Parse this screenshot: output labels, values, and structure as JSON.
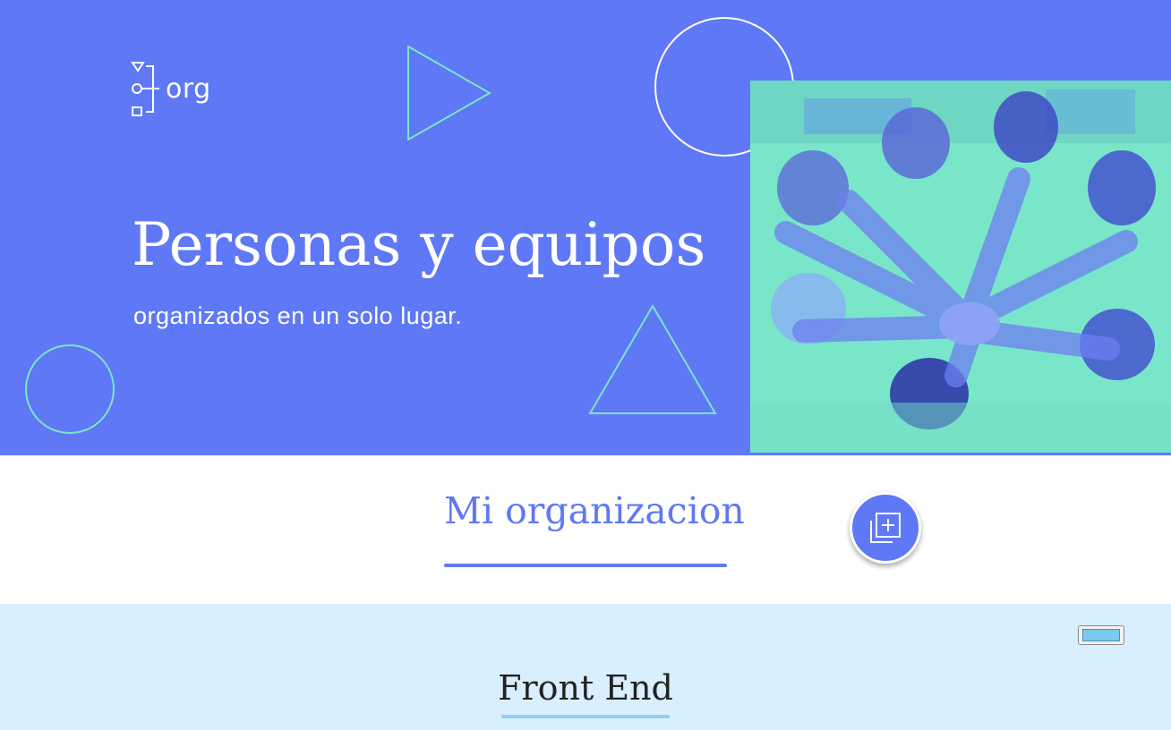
{
  "colors": {
    "brand_blue": "#5f78f5",
    "accent_teal": "#7ae6c9",
    "team_background": "#d9effd",
    "team_underline": "#90cff0"
  },
  "header": {
    "logo": {
      "text": "org",
      "icon": "org-chart-icon"
    },
    "title": "Personas y equipos",
    "subtitle": "organizados en un solo lugar.",
    "photo": {
      "subject": "team-hands-together-photo",
      "tint": "#7ae6c9"
    }
  },
  "organization": {
    "title": "Mi organizacion",
    "add_button_icon": "add-copy-icon"
  },
  "team": {
    "name": "Front End",
    "toggle_icon": "toggle-icon"
  }
}
